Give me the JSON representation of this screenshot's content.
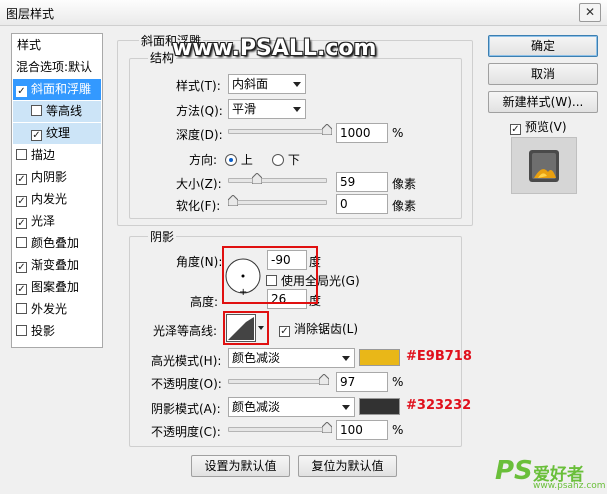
{
  "window": {
    "title": "图层样式",
    "close_glyph": "✕"
  },
  "style_list": {
    "header": "样式",
    "items": [
      {
        "label": "混合选项:默认",
        "checkbox": false,
        "checked": false
      },
      {
        "label": "斜面和浮雕",
        "checkbox": true,
        "checked": true,
        "selected": true
      },
      {
        "label": "等高线",
        "checkbox": true,
        "checked": false,
        "sub": true
      },
      {
        "label": "纹理",
        "checkbox": true,
        "checked": true,
        "sub": true
      },
      {
        "label": "描边",
        "checkbox": true,
        "checked": false
      },
      {
        "label": "内阴影",
        "checkbox": true,
        "checked": true
      },
      {
        "label": "内发光",
        "checkbox": true,
        "checked": true
      },
      {
        "label": "光泽",
        "checkbox": true,
        "checked": true
      },
      {
        "label": "颜色叠加",
        "checkbox": true,
        "checked": false
      },
      {
        "label": "渐变叠加",
        "checkbox": true,
        "checked": true
      },
      {
        "label": "图案叠加",
        "checkbox": true,
        "checked": true
      },
      {
        "label": "外发光",
        "checkbox": true,
        "checked": false
      },
      {
        "label": "投影",
        "checkbox": true,
        "checked": false
      }
    ]
  },
  "bevel": {
    "group_title": "斜面和浮雕",
    "structure_title": "结构",
    "style_label": "样式(T):",
    "style_value": "内斜面",
    "method_label": "方法(Q):",
    "method_value": "平滑",
    "depth_label": "深度(D):",
    "depth_value": "1000",
    "depth_level": 1.0,
    "percent": "%",
    "direction_label": "方向:",
    "dir_up": "上",
    "dir_down": "下",
    "direction_selected": "上",
    "size_label": "大小(Z):",
    "size_value": "59",
    "size_level": 0.25,
    "soften_label": "软化(F):",
    "soften_value": "0",
    "soften_level": 0.0,
    "px_unit": "像素"
  },
  "shading": {
    "title": "阴影",
    "angle_label": "角度(N):",
    "angle_value": "-90",
    "degree": "度",
    "global_light_label": "使用全局光(G)",
    "global_light_checked": false,
    "altitude_label": "高度:",
    "altitude_value": "26",
    "gloss_contour_label": "光泽等高线:",
    "anti_alias_label": "消除锯齿(L)",
    "anti_alias_checked": true,
    "highlight_mode_label": "高光模式(H):",
    "highlight_mode_value": "颜色减淡",
    "highlight_color": "#E9B718",
    "highlight_hex": "#E9B718",
    "opacity1_label": "不透明度(O):",
    "opacity1_value": "97",
    "opacity1_level": 0.97,
    "shadow_mode_label": "阴影模式(A):",
    "shadow_mode_value": "颜色减淡",
    "shadow_color": "#323232",
    "shadow_hex": "#323232",
    "opacity2_label": "不透明度(C):",
    "opacity2_value": "100",
    "opacity2_level": 1.0,
    "percent": "%"
  },
  "footer": {
    "set_default": "设置为默认值",
    "reset_default": "复位为默认值"
  },
  "side": {
    "ok": "确定",
    "cancel": "取消",
    "new_style": "新建样式(W)...",
    "preview_label": "预览(V)",
    "preview_checked": true
  },
  "watermark": "www.PSALL.com",
  "logo": {
    "ps": "PS",
    "cn": "爱好者",
    "url": "www.psahz.com"
  },
  "check_glyph": "✓"
}
